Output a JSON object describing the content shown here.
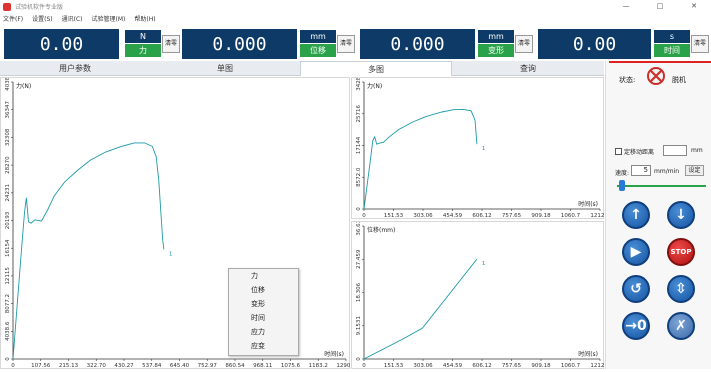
{
  "window": {
    "title": "试验机软件专业版",
    "minimize": "—",
    "maximize": "□",
    "close": "✕"
  },
  "menu": [
    "文件(F)",
    "设置(S)",
    "通讯(C)",
    "试验管理(M)",
    "帮助(H)"
  ],
  "gauges": [
    {
      "value": "0.00",
      "unit": "N",
      "quantity": "力",
      "zero_label": "清零"
    },
    {
      "value": "0.000",
      "unit": "mm",
      "quantity": "位移",
      "zero_label": "清零"
    },
    {
      "value": "0.000",
      "unit": "mm",
      "quantity": "变形",
      "zero_label": "清零"
    },
    {
      "value": "0.00",
      "unit": "s",
      "quantity": "时间",
      "zero_label": "清零"
    }
  ],
  "tabs": [
    "用户参数",
    "单图",
    "多图",
    "查询"
  ],
  "active_tab": "多图",
  "context_menu": [
    "力",
    "位移",
    "变形",
    "时间",
    "应力",
    "应变"
  ],
  "side": {
    "status_label": "状态:",
    "status_value": "脱机",
    "fixed_move_label": "定移动距离",
    "fixed_move_unit": "mm",
    "speed_label": "速度:",
    "speed_value": "5",
    "speed_unit": "mm/min",
    "set_label": "设定",
    "stop_label": "STOP"
  },
  "chart_data": [
    {
      "type": "line",
      "ylabel": "力(N)",
      "xlabel": "时间(s)",
      "y_ticks": [
        "0",
        "4038.6",
        "8077.2",
        "12115",
        "16154",
        "20193",
        "24231",
        "28270",
        "32308",
        "36347",
        "40385"
      ],
      "x_ticks": [
        "0",
        "107.56",
        "215.13",
        "322.70",
        "430.27",
        "537.84",
        "645.40",
        "752.97",
        "860.54",
        "968.11",
        "1075.6",
        "1183.2",
        "1290.8"
      ],
      "xlim": [
        0,
        1290.8
      ],
      "ylim": [
        0,
        40385
      ],
      "series_label": "1",
      "x": [
        0,
        30,
        45,
        52,
        60,
        70,
        85,
        110,
        135,
        160,
        200,
        250,
        300,
        360,
        420,
        470,
        510,
        540,
        555,
        565,
        572,
        580,
        585
      ],
      "y": [
        0,
        14500,
        21500,
        23500,
        20000,
        19800,
        20300,
        20100,
        21800,
        23800,
        25800,
        27500,
        29000,
        30200,
        31000,
        31500,
        31500,
        31000,
        29500,
        26000,
        22000,
        17500,
        16000
      ]
    },
    {
      "type": "line",
      "ylabel": "力(N)",
      "xlabel": "时间(s)",
      "y_ticks": [
        "0",
        "8572.0",
        "17144",
        "25716",
        "34288"
      ],
      "x_ticks": [
        "0",
        "151.53",
        "303.06",
        "454.59",
        "606.12",
        "757.65",
        "909.18",
        "1060.7",
        "1212.2"
      ],
      "xlim": [
        0,
        1212.2
      ],
      "ylim": [
        0,
        34288
      ],
      "series_label": "1",
      "x": [
        0,
        30,
        45,
        55,
        65,
        80,
        100,
        130,
        180,
        250,
        320,
        400,
        460,
        510,
        550,
        570,
        580
      ],
      "y": [
        0,
        12000,
        18500,
        19500,
        17500,
        17800,
        18000,
        19500,
        21500,
        23500,
        25000,
        26200,
        26800,
        26900,
        26500,
        24000,
        17500
      ]
    },
    {
      "type": "line",
      "ylabel": "位移(mm)",
      "xlabel": "时间(s)",
      "y_ticks": [
        "0",
        "9.1531",
        "18.306",
        "27.459",
        "36.612"
      ],
      "x_ticks": [
        "0",
        "151.53",
        "303.06",
        "454.59",
        "606.12",
        "757.65",
        "909.18",
        "1060.7",
        "1212.2"
      ],
      "xlim": [
        0,
        1212.2
      ],
      "ylim": [
        0,
        36.612
      ],
      "series_label": "1",
      "x": [
        0,
        200,
        300,
        580
      ],
      "y": [
        0,
        5.5,
        8.5,
        27.5
      ]
    }
  ]
}
